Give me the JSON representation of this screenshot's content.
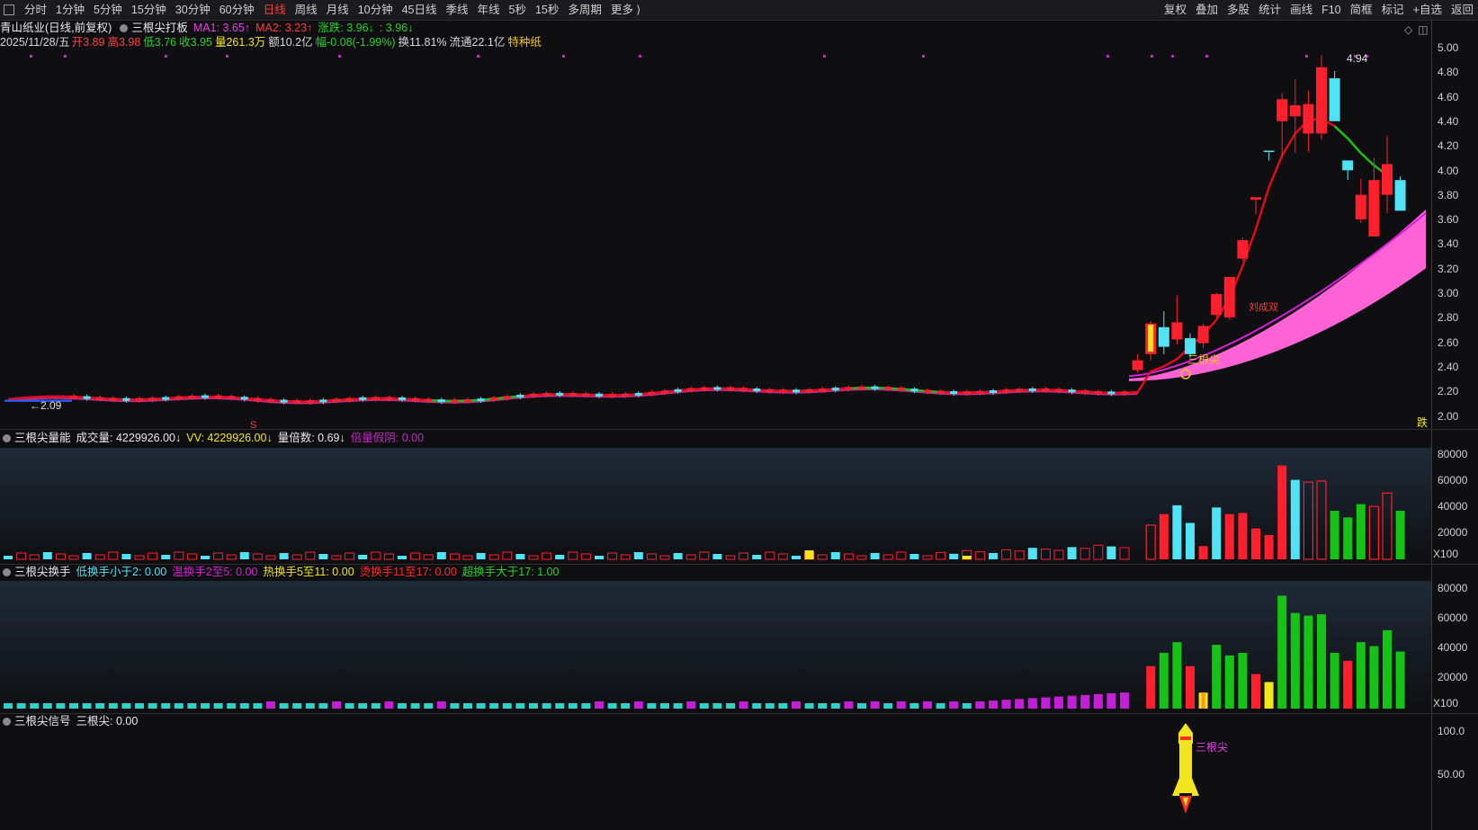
{
  "toolbar": {
    "periods": [
      "分时",
      "1分钟",
      "5分钟",
      "15分钟",
      "30分钟",
      "60分钟",
      "日线",
      "周线",
      "月线",
      "10分钟",
      "45日线",
      "季线",
      "年线",
      "5秒",
      "15秒",
      "多周期",
      "更多 ⟩"
    ],
    "active_period": "日线",
    "tools": [
      "复权",
      "叠加",
      "多股",
      "统计",
      "画线",
      "F10",
      "简框",
      "标记",
      "+自选",
      "返回"
    ]
  },
  "main_panel": {
    "stock_title": "青山纸业(日线,前复权)",
    "indicator_name": "三根尖打板",
    "ma1": "MA1: 3.65↑",
    "ma2": "MA2: 3.23↑",
    "zhangdie": "涨跌: 3.96↓",
    "extra": ": 3.96↓",
    "date": "2025/11/28/五",
    "open": "开3.89",
    "high": "高3.98",
    "low": "低3.76",
    "close": "收3.95",
    "volume": "量261.3万",
    "amount": "额10.2亿",
    "amplitude": "幅-0.08(-1.99%)",
    "turnover": "换11.81%",
    "float_cap": "流通22.1亿",
    "tag": "特种纸",
    "high_mark": "4.94",
    "low_mark": "←2.09",
    "label_sangen": "三根尖",
    "label_zhudao": "刘成双",
    "label_die": "跌",
    "label_s": "S",
    "axis": [
      "5.00",
      "4.80",
      "4.60",
      "4.40",
      "4.20",
      "4.00",
      "3.80",
      "3.60",
      "3.40",
      "3.20",
      "3.00",
      "2.80",
      "2.60",
      "2.40",
      "2.20",
      "2.00"
    ]
  },
  "volume_panel": {
    "name": "三根尖量能",
    "vol": "成交量: 4229926.00↓",
    "vv": "VV: 4229926.00↓",
    "ratio": "量倍数: 0.69↓",
    "beiliang": "倍量假阴: 0.00",
    "axis": [
      "80000",
      "60000",
      "40000",
      "20000"
    ],
    "unit": "X100"
  },
  "turnover_panel": {
    "name": "三根尖换手",
    "low": "低换手小于2: 0.00",
    "warm": "温换手2至5: 0.00",
    "hot": "热换手5至11: 0.00",
    "burn": "烫换手11至17: 0.00",
    "super": "超换手大于17: 1.00",
    "axis": [
      "80000",
      "60000",
      "40000",
      "20000"
    ],
    "unit": "X100"
  },
  "signal_panel": {
    "name": "三根尖信号",
    "value": "三根尖: 0.00",
    "axis": [
      "100.0",
      "50.00"
    ],
    "rocket_label": "三根尖"
  },
  "colors": {
    "up": "#ff1f2d",
    "down": "#4fe3f5",
    "ma1": "#e50b1a",
    "ma2": "#d61fd6",
    "band": "#ff62d4",
    "green": "#15c315",
    "yellow": "#f2e51d"
  },
  "chart_data": {
    "type": "candlestick",
    "price_range": [
      2.0,
      5.0
    ],
    "late_candles": [
      {
        "o": 2.37,
        "c": 2.45,
        "h": 2.5,
        "l": 2.35
      },
      {
        "o": 2.5,
        "c": 2.75,
        "h": 2.77,
        "l": 2.45
      },
      {
        "o": 2.72,
        "c": 2.56,
        "h": 2.85,
        "l": 2.5
      },
      {
        "o": 2.62,
        "c": 2.76,
        "h": 2.98,
        "l": 2.58
      },
      {
        "o": 2.63,
        "c": 2.5,
        "h": 2.67,
        "l": 2.47
      },
      {
        "o": 2.59,
        "c": 2.73,
        "h": 2.75,
        "l": 2.55
      },
      {
        "o": 2.82,
        "c": 2.99,
        "h": 3.0,
        "l": 2.8
      },
      {
        "o": 2.8,
        "c": 3.13,
        "h": 3.13,
        "l": 2.78
      },
      {
        "o": 3.28,
        "c": 3.43,
        "h": 3.45,
        "l": 3.26
      },
      {
        "o": 3.76,
        "c": 3.78,
        "h": 3.78,
        "l": 3.64
      },
      {
        "o": 4.16,
        "c": 4.15,
        "h": 4.16,
        "l": 4.08
      },
      {
        "o": 4.4,
        "c": 4.58,
        "h": 4.63,
        "l": 4.11
      },
      {
        "o": 4.44,
        "c": 4.53,
        "h": 4.74,
        "l": 4.14
      },
      {
        "o": 4.3,
        "c": 4.54,
        "h": 4.65,
        "l": 4.15
      },
      {
        "o": 4.3,
        "c": 4.84,
        "h": 4.94,
        "l": 4.25
      },
      {
        "o": 4.75,
        "c": 4.4,
        "h": 4.81,
        "l": 4.4
      },
      {
        "o": 4.08,
        "c": 4.0,
        "h": 4.08,
        "l": 3.92
      },
      {
        "o": 3.6,
        "c": 3.8,
        "h": 3.93,
        "l": 3.57
      },
      {
        "o": 3.46,
        "c": 3.92,
        "h": 4.1,
        "l": 3.46
      },
      {
        "o": 3.8,
        "c": 4.05,
        "h": 4.28,
        "l": 3.65
      },
      {
        "o": 3.92,
        "c": 3.67,
        "h": 3.95,
        "l": 3.67
      }
    ],
    "late_volume": [
      310,
      410,
      490,
      330,
      120,
      470,
      410,
      420,
      280,
      220,
      850,
      720,
      700,
      710,
      440,
      380,
      500,
      480,
      600,
      440
    ],
    "late_turnover": [
      320,
      420,
      500,
      320,
      120,
      480,
      400,
      420,
      260,
      200,
      850,
      720,
      700,
      710,
      420,
      360,
      500,
      470,
      590,
      430
    ]
  }
}
